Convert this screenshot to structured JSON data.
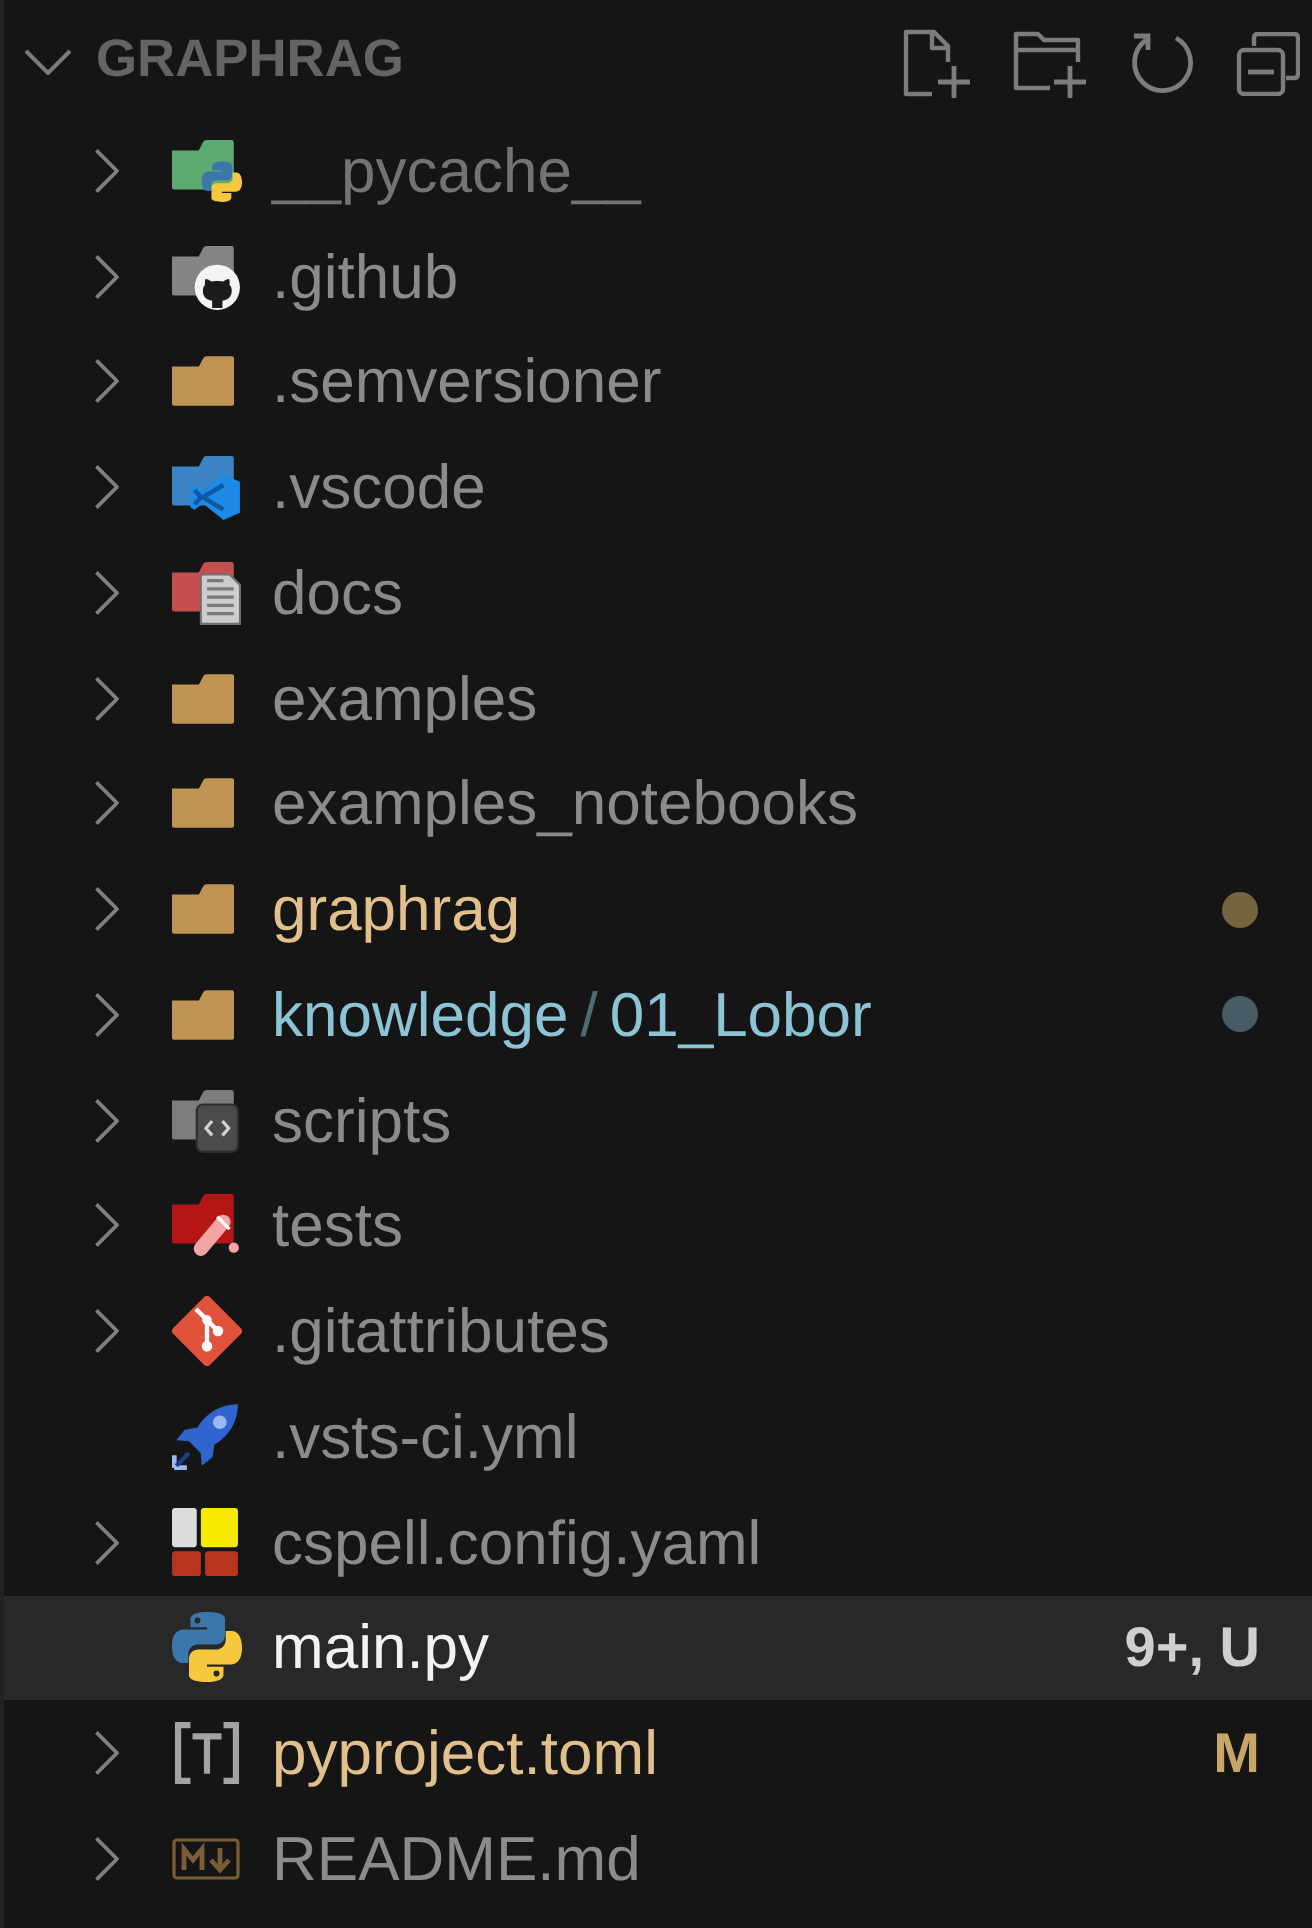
{
  "explorer": {
    "title": "GRAPHRAG",
    "expanded": true
  },
  "items": [
    {
      "name": "__pycache__",
      "kind": "pycache",
      "expanded": false,
      "color": "#737373",
      "selected": false
    },
    {
      "name": ".github",
      "kind": "github",
      "expanded": false,
      "selected": false
    },
    {
      "name": ".semversioner",
      "kind": "folder",
      "expanded": false,
      "selected": false
    },
    {
      "name": ".vscode",
      "kind": "vscode",
      "expanded": false,
      "selected": false
    },
    {
      "name": "docs",
      "kind": "docs",
      "expanded": false,
      "selected": false
    },
    {
      "name": "examples",
      "kind": "folder",
      "expanded": false,
      "selected": false
    },
    {
      "name": "examples_notebooks",
      "kind": "folder",
      "expanded": false,
      "selected": false
    },
    {
      "name": "graphrag",
      "kind": "folder",
      "expanded": false,
      "color": "#e2c08d",
      "dot": {
        "color": "#75653f"
      },
      "selected": false
    },
    {
      "segments": [
        "knowledge",
        "01_Lobor"
      ],
      "separator": "/",
      "kind": "folder",
      "expanded": false,
      "color": "#8cc4d6",
      "dot": {
        "color": "#465b64"
      },
      "selected": false
    },
    {
      "name": "scripts",
      "kind": "scripts",
      "expanded": false,
      "selected": false
    },
    {
      "name": "tests",
      "kind": "tests",
      "expanded": false,
      "selected": false
    },
    {
      "name": ".gitattributes",
      "kind": "git",
      "expanded": false,
      "selected": false
    },
    {
      "name": ".vsts-ci.yml",
      "kind": "rocket",
      "selected": false
    },
    {
      "name": "cspell.config.yaml",
      "kind": "cspell",
      "expanded": false,
      "selected": false
    },
    {
      "name": "main.py",
      "kind": "python",
      "color": "#f2f2f2",
      "badge": {
        "text": "9+, U",
        "color": "#cfcfcf"
      },
      "selected": true
    },
    {
      "name": "pyproject.toml",
      "kind": "toml",
      "expanded": false,
      "color": "#e2c08d",
      "badge": {
        "text": "M",
        "color": "#c8a66a"
      },
      "selected": false
    },
    {
      "name": "README.md",
      "kind": "markdown",
      "expanded": false,
      "selected": false
    }
  ]
}
